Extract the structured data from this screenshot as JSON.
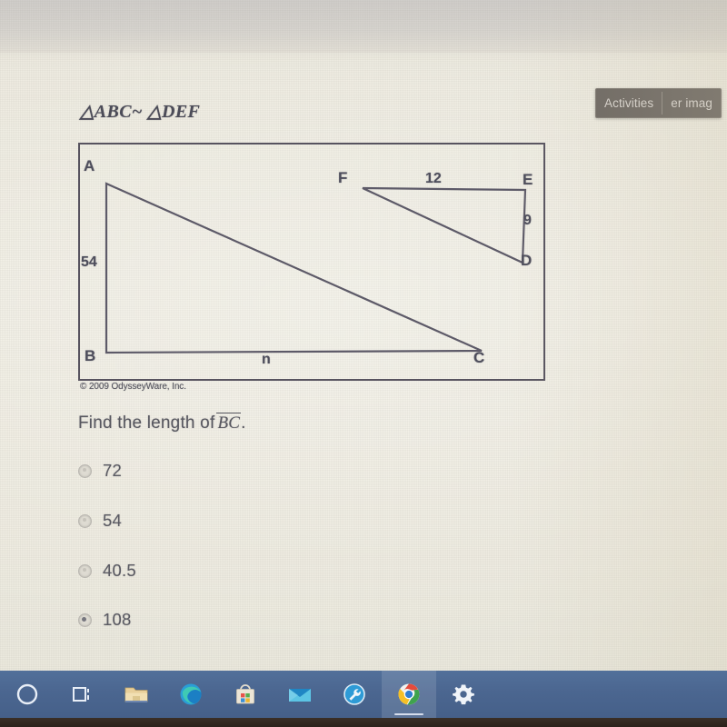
{
  "overlay": {
    "left_label": "Activities",
    "right_label": "er imag"
  },
  "question": {
    "similarity_statement": "△ABC~ △DEF",
    "prompt_prefix": "Find the length of",
    "prompt_segment": "BC",
    "prompt_suffix": ".",
    "copyright": "© 2009 OdysseyWare, Inc."
  },
  "figure": {
    "labels": {
      "a": "A",
      "b": "B",
      "c": "C",
      "d": "D",
      "e": "E",
      "f": "F"
    },
    "values": {
      "ab": "54",
      "bc": "n",
      "fe": "12",
      "ed": "9"
    },
    "stroke_color": "#5d5a68",
    "border_color": "#57535f"
  },
  "options": [
    {
      "label": "72",
      "selected": false
    },
    {
      "label": "54",
      "selected": false
    },
    {
      "label": "40.5",
      "selected": false
    },
    {
      "label": "108",
      "selected": true
    }
  ],
  "taskbar": {
    "items": [
      {
        "name": "cortana-icon",
        "active": false
      },
      {
        "name": "task-view-icon",
        "active": false
      },
      {
        "name": "file-explorer-icon",
        "active": false
      },
      {
        "name": "edge-browser-icon",
        "active": false
      },
      {
        "name": "microsoft-store-icon",
        "active": false
      },
      {
        "name": "mail-icon",
        "active": false
      },
      {
        "name": "tools-wrench-icon",
        "active": false
      },
      {
        "name": "chrome-browser-icon",
        "active": true
      },
      {
        "name": "settings-gear-icon",
        "active": false
      }
    ]
  }
}
